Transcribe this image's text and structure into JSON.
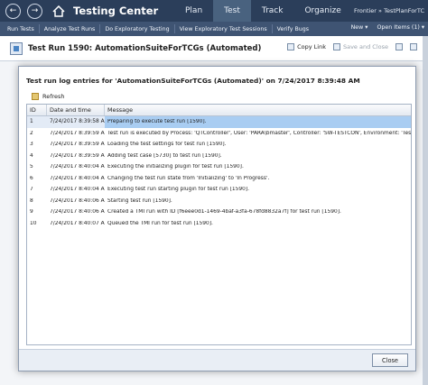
{
  "top_nav": {
    "back_glyph": "←",
    "forward_glyph": "→",
    "app_title": "Testing Center",
    "tabs": [
      "Plan",
      "Test",
      "Track",
      "Organize"
    ],
    "active_tab": "Test",
    "project": "Frontier » TestPlanForTC"
  },
  "toolbar": {
    "items": [
      "Run Tests",
      "Analyze Test Runs",
      "Do Exploratory Testing",
      "View Exploratory Test Sessions",
      "Verify Bugs"
    ],
    "new_label": "New ▾",
    "open_items_label": "Open Items (1) ▾"
  },
  "pane": {
    "title": "Test Run 1590: AutomationSuiteForTCGs (Automated)",
    "copy_link_label": "Copy Link",
    "save_close_label": "Save and Close"
  },
  "dialog": {
    "title": "Test run log entries for 'AutomationSuiteForTCGs (Automated)' on 7/24/2017 8:39:48 AM",
    "refresh_label": "Refresh",
    "columns": [
      "ID",
      "Date and time",
      "Message"
    ],
    "rows": [
      {
        "id": "1",
        "datetime": "7/24/2017 8:39:58 AM",
        "message": "Preparing to execute test run [1590]."
      },
      {
        "id": "2",
        "datetime": "7/24/2017 8:39:59 AM",
        "message": "Test run is executed by Process: 'QTController', User: 'PARA\\bmaster', Controller: 'SW-TESTCON', Environment: 'TestE..."
      },
      {
        "id": "3",
        "datetime": "7/24/2017 8:39:59 AM",
        "message": "Loading the test settings for test run [1590]."
      },
      {
        "id": "4",
        "datetime": "7/24/2017 8:39:59 AM",
        "message": "Adding test case [5730] to test run [1590]."
      },
      {
        "id": "5",
        "datetime": "7/24/2017 8:40:04 AM",
        "message": "Executing the initializing plugin for test run [1590]."
      },
      {
        "id": "6",
        "datetime": "7/24/2017 8:40:04 AM",
        "message": "Changing the test run state from 'Initializing' to 'In Progress'."
      },
      {
        "id": "7",
        "datetime": "7/24/2017 8:40:04 AM",
        "message": "Executing test run starting plugin for test run [1590]."
      },
      {
        "id": "8",
        "datetime": "7/24/2017 8:40:06 AM",
        "message": "Starting test run [1590]."
      },
      {
        "id": "9",
        "datetime": "7/24/2017 8:40:06 AM",
        "message": "Created a TMI run with ID [f6eee0d1-1469-4baf-a3fa-678fd8832a7f] for test run [1590]."
      },
      {
        "id": "10",
        "datetime": "7/24/2017 8:40:07 AM",
        "message": "Queued the TMI run for test run [1590]."
      }
    ],
    "selected_row": 0,
    "close_label": "Close"
  }
}
